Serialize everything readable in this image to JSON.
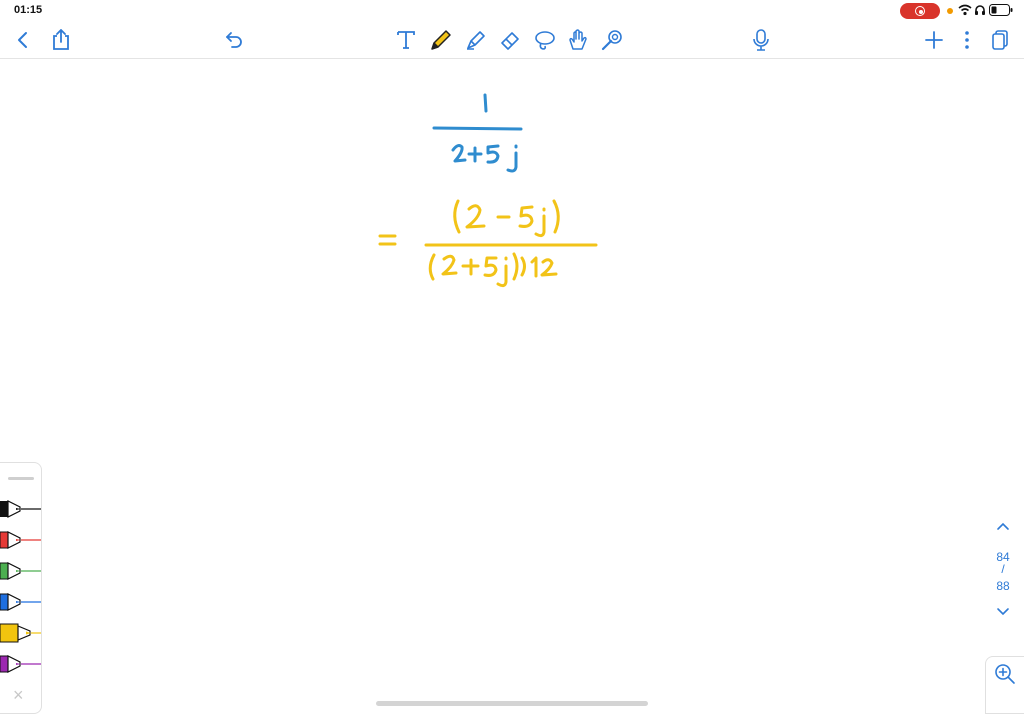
{
  "status_bar": {
    "time": "01:15"
  },
  "toolbar": {
    "left": [
      "back-icon",
      "share-icon",
      "undo-icon"
    ],
    "tools": [
      "text-tool-icon",
      "pen-tool-icon",
      "highlighter-tool-icon",
      "eraser-tool-icon",
      "lasso-tool-icon",
      "hand-tool-icon",
      "laser-pointer-icon"
    ],
    "right": [
      "microphone-icon",
      "add-page-icon",
      "more-icon",
      "pages-icon"
    ]
  },
  "pen_tray": {
    "pens": [
      {
        "name": "black-pen",
        "color": "#111111"
      },
      {
        "name": "red-pen",
        "color": "#e53935"
      },
      {
        "name": "green-pen",
        "color": "#4caf50"
      },
      {
        "name": "blue-pen",
        "color": "#1e6fe0"
      },
      {
        "name": "yellow-highlighter",
        "color": "#f1c40f"
      },
      {
        "name": "purple-pen",
        "color": "#9c27b0"
      }
    ],
    "close_glyph": "×"
  },
  "pager": {
    "current": "84",
    "separator": "/",
    "total": "88"
  },
  "ink_colors": {
    "blue": "#2f8ccf",
    "yellow": "#f2c318"
  }
}
